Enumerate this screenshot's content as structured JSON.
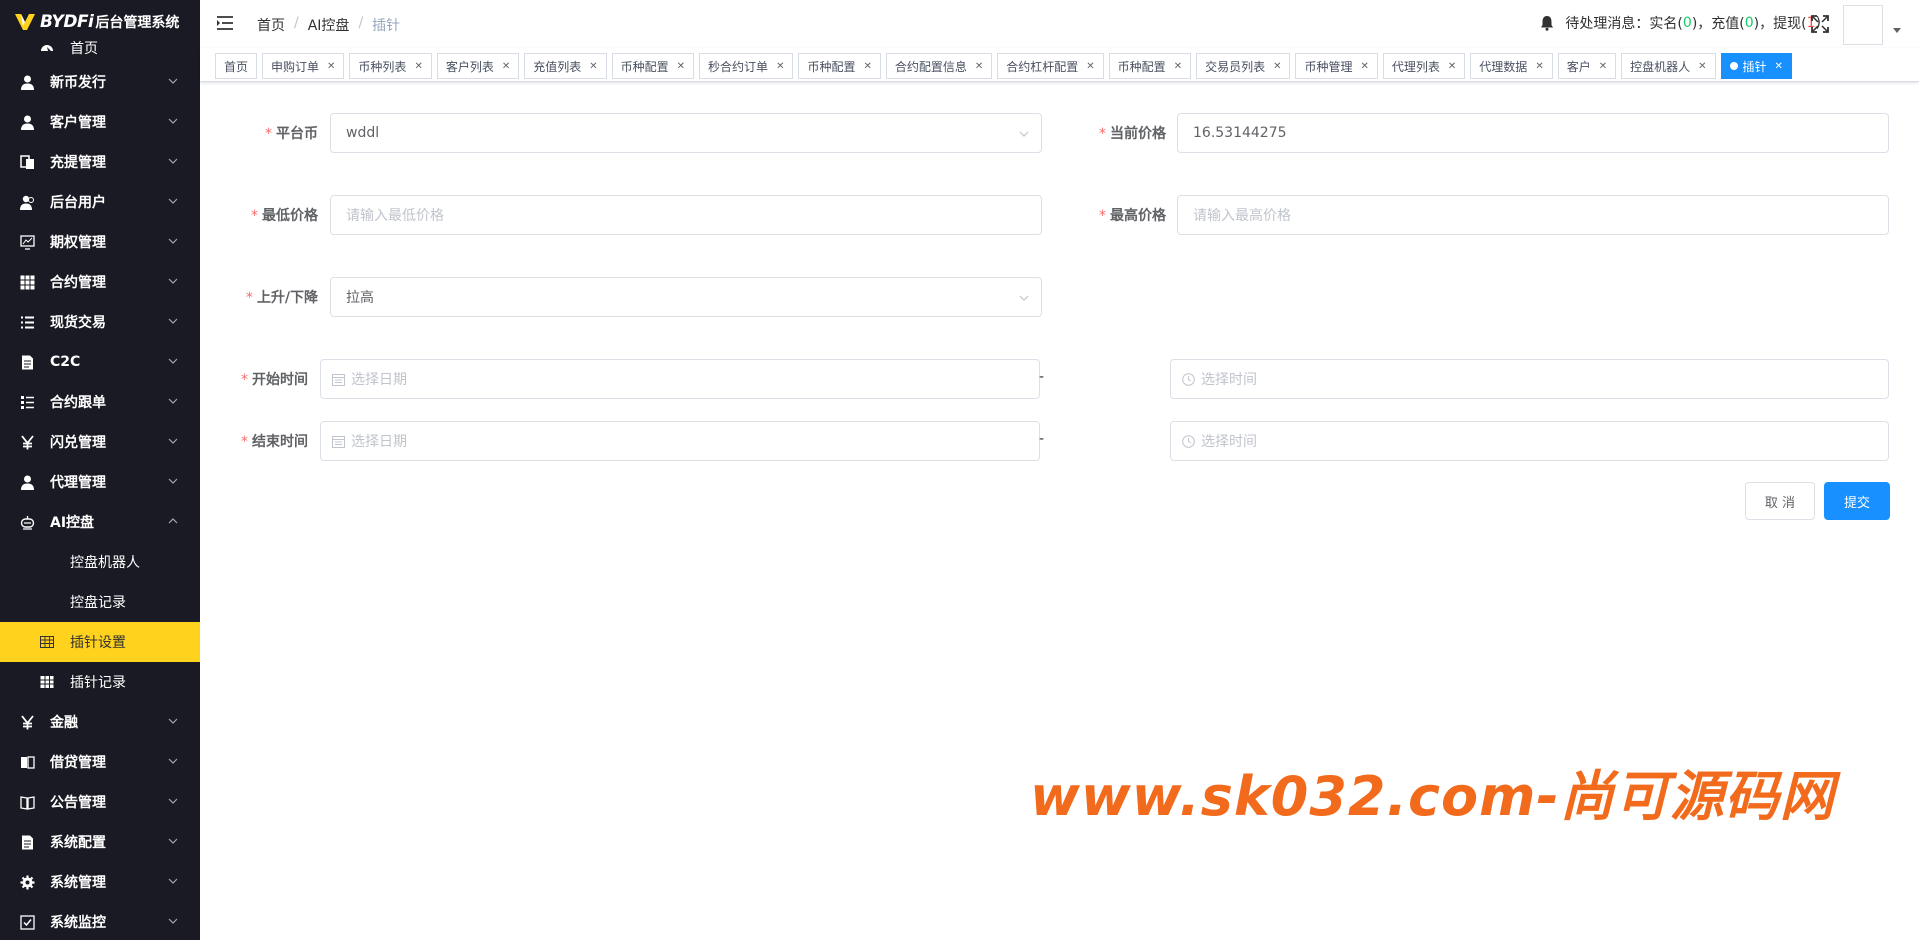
{
  "sidebar": {
    "logo": {
      "brand": "BYDFi",
      "system": "后台管理系统"
    },
    "home": "首页",
    "items": [
      {
        "label": "新币发行",
        "icon": "user-icon"
      },
      {
        "label": "客户管理",
        "icon": "user-icon"
      },
      {
        "label": "充提管理",
        "icon": "documents-icon"
      },
      {
        "label": "后台用户",
        "icon": "users-icon"
      },
      {
        "label": "期权管理",
        "icon": "monitor-chart-icon"
      },
      {
        "label": "合约管理",
        "icon": "grid-icon"
      },
      {
        "label": "现货交易",
        "icon": "list-icon"
      },
      {
        "label": "C2C",
        "icon": "document-icon"
      },
      {
        "label": "合约跟单",
        "icon": "list-tree-icon"
      },
      {
        "label": "闪兑管理",
        "icon": "yen-icon"
      },
      {
        "label": "代理管理",
        "icon": "user-icon"
      }
    ],
    "ai_group": {
      "label": "AI控盘",
      "icon": "robot-icon",
      "children": [
        {
          "label": "控盘机器人"
        },
        {
          "label": "控盘记录"
        },
        {
          "label": "插针设置",
          "icon": "table-icon",
          "active": true
        },
        {
          "label": "插针记录",
          "icon": "table-icon"
        }
      ]
    },
    "items_after": [
      {
        "label": "金融",
        "icon": "yen-icon"
      },
      {
        "label": "借贷管理",
        "icon": "book-icon"
      },
      {
        "label": "公告管理",
        "icon": "open-book-icon"
      },
      {
        "label": "系统配置",
        "icon": "document-icon"
      },
      {
        "label": "系统管理",
        "icon": "gear-icon"
      },
      {
        "label": "系统监控",
        "icon": "check-square-icon"
      }
    ]
  },
  "header": {
    "breadcrumb": [
      "首页",
      "AI控盘",
      "插针"
    ],
    "notify": {
      "prefix": "待处理消息：实名(",
      "realname": "0",
      "mid1": ")，充值(",
      "recharge": "0",
      "mid2": ")，提现(",
      "withdraw": "1",
      "suffix": ")"
    }
  },
  "tags": [
    "首页",
    "申购订单",
    "币种列表",
    "客户列表",
    "充值列表",
    "币种配置",
    "秒合约订单",
    "币种配置",
    "合约配置信息",
    "合约杠杆配置",
    "币种配置",
    "交易员列表",
    "币种管理",
    "代理列表",
    "代理数据",
    "客户",
    "控盘机器人",
    "插针"
  ],
  "form": {
    "platform_coin": {
      "label": "平台币",
      "value": "wddl"
    },
    "current_price": {
      "label": "当前价格",
      "value": "16.53144275"
    },
    "min_price": {
      "label": "最低价格",
      "placeholder": "请输入最低价格"
    },
    "max_price": {
      "label": "最高价格",
      "placeholder": "请输入最高价格"
    },
    "direction": {
      "label": "上升/下降",
      "value": "拉高"
    },
    "start_time": {
      "label": "开始时间",
      "date_placeholder": "选择日期",
      "time_placeholder": "选择时间"
    },
    "end_time": {
      "label": "结束时间",
      "date_placeholder": "选择日期",
      "time_placeholder": "选择时间"
    },
    "range_sep": "-",
    "cancel": "取 消",
    "submit": "提交"
  },
  "watermark": "www.sk032.com-尚可源码网",
  "colors": {
    "sidebar_bg": "#191a23",
    "active_menu": "#ffd21e",
    "primary": "#1890ff",
    "required": "#f56c6c",
    "watermark": "#f26b1d"
  }
}
